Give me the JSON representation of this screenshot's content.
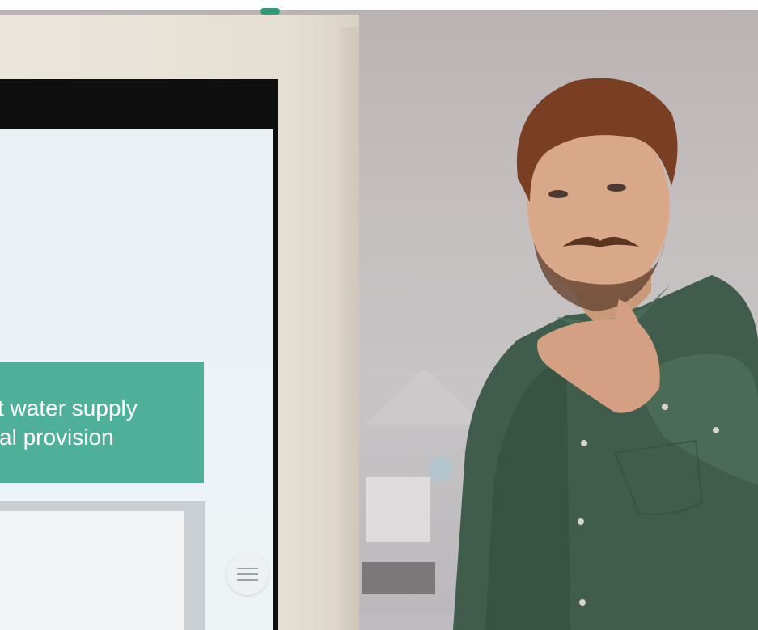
{
  "kiosk": {
    "banner_lines": [
      "t water supply",
      "al provision"
    ]
  },
  "icons": {
    "menu": "hamburger-menu-icon"
  },
  "colors": {
    "banner": "#4fb09a",
    "shirt": "#3d5a4a",
    "hair": "#7a3e22",
    "kiosk_frame": "#e8e3d8"
  }
}
